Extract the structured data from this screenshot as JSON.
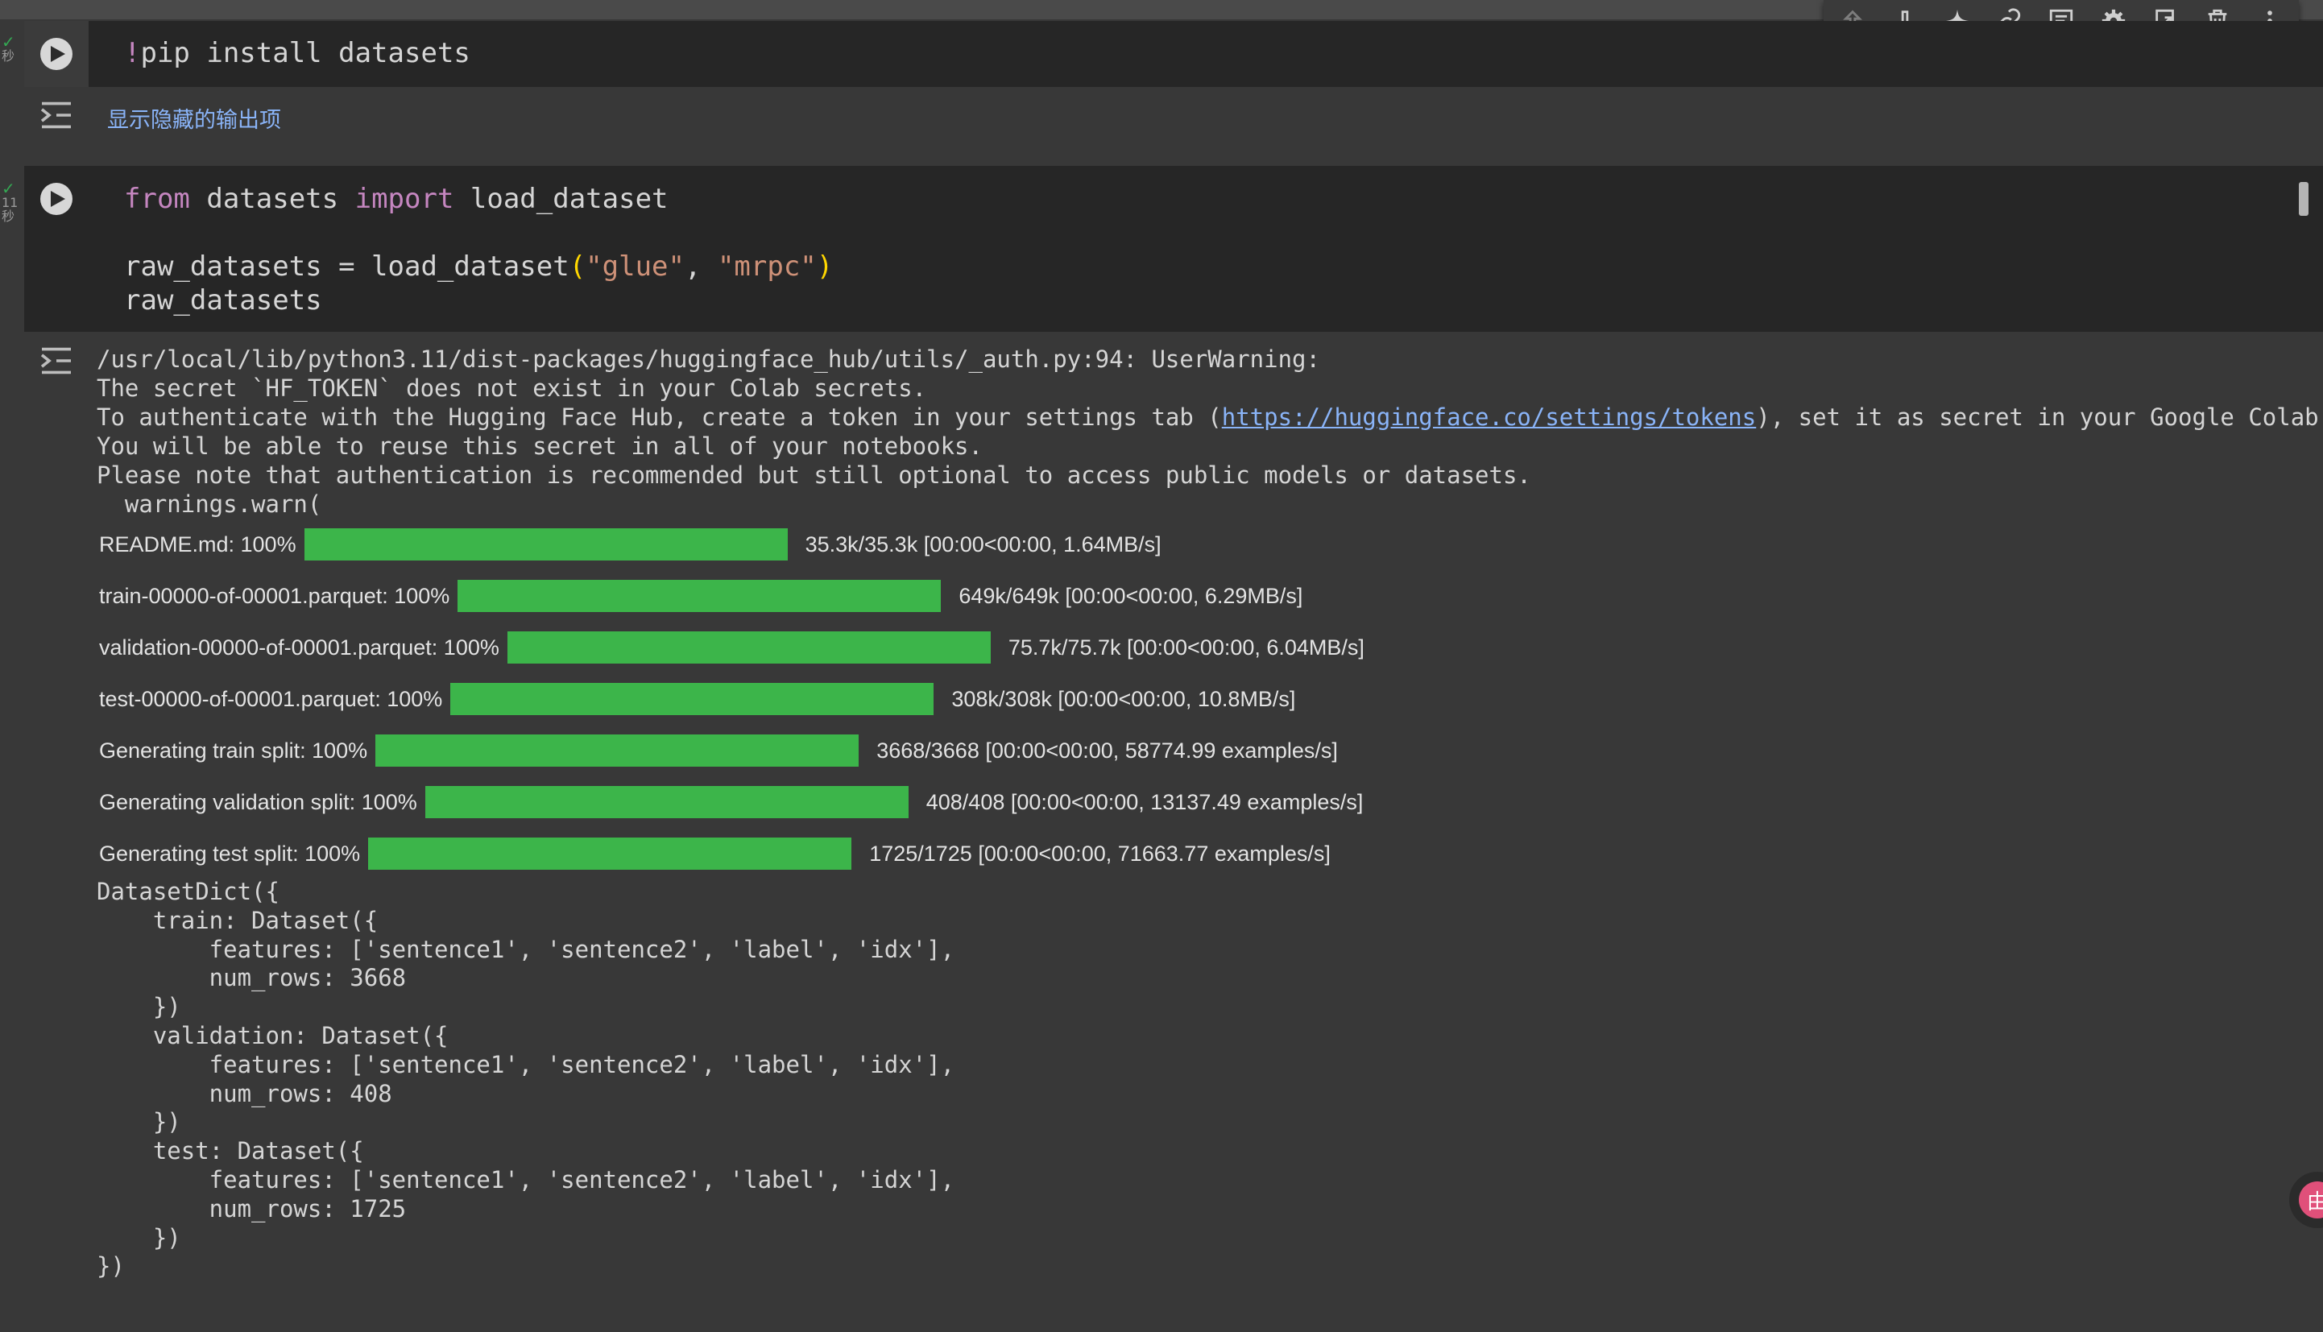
{
  "toolbar": {
    "buttons": [
      {
        "name": "move-up-icon",
        "enabled": false
      },
      {
        "name": "move-down-icon",
        "enabled": true
      },
      {
        "name": "gemini-sparkle-icon",
        "enabled": true
      },
      {
        "name": "link-icon",
        "enabled": true
      },
      {
        "name": "comment-icon",
        "enabled": true
      },
      {
        "name": "gear-icon",
        "enabled": true
      },
      {
        "name": "mirror-cell-icon",
        "enabled": true
      },
      {
        "name": "trash-icon",
        "enabled": true
      },
      {
        "name": "more-vert-icon",
        "enabled": true
      }
    ]
  },
  "cell1": {
    "status_check": "✓",
    "status_time": "秒",
    "code": {
      "bang": "!",
      "rest": "pip install datasets"
    },
    "hidden_output_link": "显示隐藏的输出项"
  },
  "cell2": {
    "status_check": "✓",
    "status_time_value": "11",
    "status_time_unit": "秒",
    "code": {
      "kw_from": "from",
      "module": " datasets ",
      "kw_import": "import",
      "name": " load_dataset",
      "line3_a": "raw_datasets = load_dataset",
      "open_paren": "(",
      "arg1": "\"glue\"",
      "comma": ", ",
      "arg2": "\"mrpc\"",
      "close_paren": ")",
      "line4": "raw_datasets"
    },
    "warning": {
      "line1": "/usr/local/lib/python3.11/dist-packages/huggingface_hub/utils/_auth.py:94: UserWarning:",
      "line2": "The secret `HF_TOKEN` does not exist in your Colab secrets.",
      "line3_pre": "To authenticate with the Hugging Face Hub, create a token in your settings tab (",
      "line3_link": "https://huggingface.co/settings/tokens",
      "line3_post": "), set it as secret in your Google Colab and r",
      "line4": "You will be able to reuse this secret in all of your notebooks.",
      "line5": "Please note that authentication is recommended but still optional to access public models or datasets.",
      "line6": "  warnings.warn("
    },
    "progress": [
      {
        "label": "README.md: 100%",
        "fill": 1.0,
        "stats": "35.3k/35.3k [00:00<00:00, 1.64MB/s]"
      },
      {
        "label": "train-00000-of-00001.parquet: 100%",
        "fill": 1.0,
        "stats": "649k/649k [00:00<00:00, 6.29MB/s]"
      },
      {
        "label": "validation-00000-of-00001.parquet: 100%",
        "fill": 1.0,
        "stats": "75.7k/75.7k [00:00<00:00, 6.04MB/s]"
      },
      {
        "label": "test-00000-of-00001.parquet: 100%",
        "fill": 1.0,
        "stats": "308k/308k [00:00<00:00, 10.8MB/s]"
      },
      {
        "label": "Generating train split: 100%",
        "fill": 1.0,
        "stats": "3668/3668 [00:00<00:00, 58774.99 examples/s]"
      },
      {
        "label": "Generating validation split: 100%",
        "fill": 1.0,
        "stats": "408/408 [00:00<00:00, 13137.49 examples/s]"
      },
      {
        "label": "Generating test split: 100%",
        "fill": 1.0,
        "stats": "1725/1725 [00:00<00:00, 71663.77 examples/s]"
      }
    ],
    "dataset_dict": [
      "DatasetDict({",
      "    train: Dataset({",
      "        features: ['sentence1', 'sentence2', 'label', 'idx'],",
      "        num_rows: 3668",
      "    })",
      "    validation: Dataset({",
      "        features: ['sentence1', 'sentence2', 'label', 'idx'],",
      "        num_rows: 408",
      "    })",
      "    test: Dataset({",
      "        features: ['sentence1', 'sentence2', 'label', 'idx'],",
      "        num_rows: 1725",
      "    })",
      "})"
    ]
  },
  "floating_avatar": {
    "glyph": "由"
  },
  "colors": {
    "accent_link": "#8ab4f8",
    "progress_green": "#3cb54a",
    "keyword": "#c586c0",
    "string": "#ce9178"
  }
}
